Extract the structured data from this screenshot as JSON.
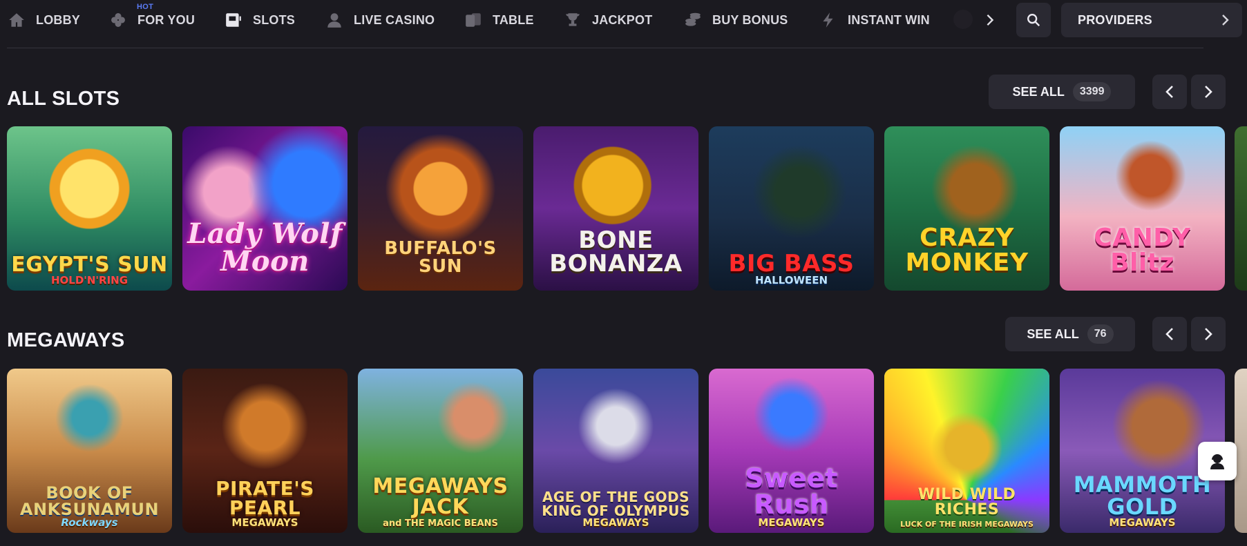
{
  "nav": {
    "items": [
      {
        "label": "LOBBY",
        "icon": "home-icon"
      },
      {
        "label": "FOR YOU",
        "icon": "clover-icon",
        "badge": "HOT"
      },
      {
        "label": "SLOTS",
        "icon": "slot-machine-icon"
      },
      {
        "label": "LIVE CASINO",
        "icon": "dealer-icon"
      },
      {
        "label": "TABLE",
        "icon": "cards-icon"
      },
      {
        "label": "JACKPOT",
        "icon": "trophy-icon"
      },
      {
        "label": "BUY BONUS",
        "icon": "coins-icon"
      },
      {
        "label": "INSTANT WIN",
        "icon": "lightning-icon"
      }
    ],
    "providers_label": "PROVIDERS"
  },
  "sections": [
    {
      "title": "ALL SLOTS",
      "see_all_label": "SEE ALL",
      "count": "3399",
      "games": [
        {
          "title": "EGYPT'S SUN",
          "sub": "HOLD'N'RING"
        },
        {
          "title": "Lady Wolf Moon",
          "sub": ""
        },
        {
          "title": "BUFFALO'S SUN",
          "sub": ""
        },
        {
          "title": "BONE BONANZA",
          "sub": ""
        },
        {
          "title": "BIG BASS",
          "sub": "HALLOWEEN"
        },
        {
          "title": "CRAZY MONKEY",
          "sub": ""
        },
        {
          "title": "CANDY Blitz",
          "sub": ""
        }
      ]
    },
    {
      "title": "MEGAWAYS",
      "see_all_label": "SEE ALL",
      "count": "76",
      "games": [
        {
          "title": "BOOK OF ANKSUNAMUN",
          "sub": "Rockways"
        },
        {
          "title": "PIRATE'S PEARL",
          "sub": "MEGAWAYS"
        },
        {
          "title": "MEGAWAYS JACK",
          "sub": "and THE MAGIC BEANS"
        },
        {
          "title": "AGE OF THE GODS KING OF OLYMPUS",
          "sub": "MEGAWAYS"
        },
        {
          "title": "Sweet Rush",
          "sub": "MEGAWAYS"
        },
        {
          "title": "WILD WILD RICHES",
          "sub": "LUCK OF THE IRISH MEGAWAYS"
        },
        {
          "title": "MAMMOTH GOLD",
          "sub": "MEGAWAYS"
        }
      ]
    }
  ]
}
